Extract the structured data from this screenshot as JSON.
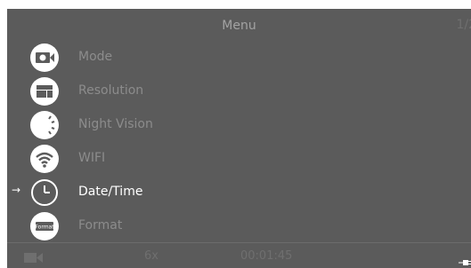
{
  "header": {
    "title": "Menu",
    "page": "1/2"
  },
  "menu": {
    "items": [
      {
        "label": "Mode",
        "icon": "camera-mode-icon"
      },
      {
        "label": "Resolution",
        "icon": "resolution-icon"
      },
      {
        "label": "Night Vision",
        "icon": "night-vision-icon"
      },
      {
        "label": "WIFI",
        "icon": "wifi-icon"
      },
      {
        "label": "Date/Time",
        "icon": "clock-icon",
        "selected": true
      },
      {
        "label": "Format",
        "icon": "format-icon",
        "icon_text": "Format"
      }
    ],
    "selected_index": 4,
    "selection_marker": "→"
  },
  "status_bar": {
    "recording_icon": "video-camera-icon",
    "zoom": "6x",
    "elapsed": "00:01:45",
    "power_icon": "plug-icon"
  },
  "colors": {
    "background": "#5b5b5b",
    "selected_text": "#ffffff",
    "inactive_text": "#8c8c8c",
    "dim_text": "#6f6f6f"
  }
}
